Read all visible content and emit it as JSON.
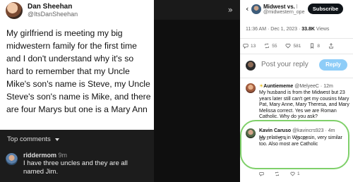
{
  "left_post": {
    "display_name": "Dan Sheehan",
    "handle": "@ItsDanSheehan",
    "text": "My girlfriend is meeting my big midwestern family for the first time and I don't understand why it's so hard to remember that my Uncle Mike's son's name is Steve, my Uncle Steve's son's name is Mike, and there are four Marys but one is a Mary Ann"
  },
  "left_comments": {
    "header": "Top comments",
    "comment": {
      "user": "riddermom",
      "time": "9m",
      "text": "I have three uncles and they are all named Jim."
    }
  },
  "right_panel": {
    "nav": {
      "name": "Midwest vs. Ev",
      "handle": "@midwestern_ope",
      "subscribe_label": "Subscribe"
    },
    "meta": {
      "time_date": "11:36 AM · Dec 1, 2023 · ",
      "views": "33.8K",
      "views_label": " Views"
    },
    "stats": {
      "replies": "13",
      "reposts": "55",
      "likes": "581",
      "bookmarks": "8"
    },
    "reply_placeholder": "Post your reply",
    "reply_button": "Reply",
    "replies": [
      {
        "name": "Auntiememe",
        "handle": "@MelyeeC · 12m",
        "text": "My husband is from the Midwest but 23 years later still can't get my cousins Mary Pat, Mary Anne, Mary Theresa, and Mary Melissa correct. Yes we are Roman Catholic. Why do you ask?",
        "replies": "1",
        "reposts": "1",
        "likes": "22"
      },
      {
        "name": "Kavin Caruso",
        "handle": "@kavincrs923 · 4m",
        "text": "My relatives in Wisconsin, very similar too. Also most are Catholic",
        "replies": "",
        "reposts": "",
        "likes": "1"
      }
    ]
  },
  "colors": {
    "highlight": "#7fd06a",
    "reply_button": "#8ecdf8",
    "subscribe_bg": "#0f1419"
  }
}
